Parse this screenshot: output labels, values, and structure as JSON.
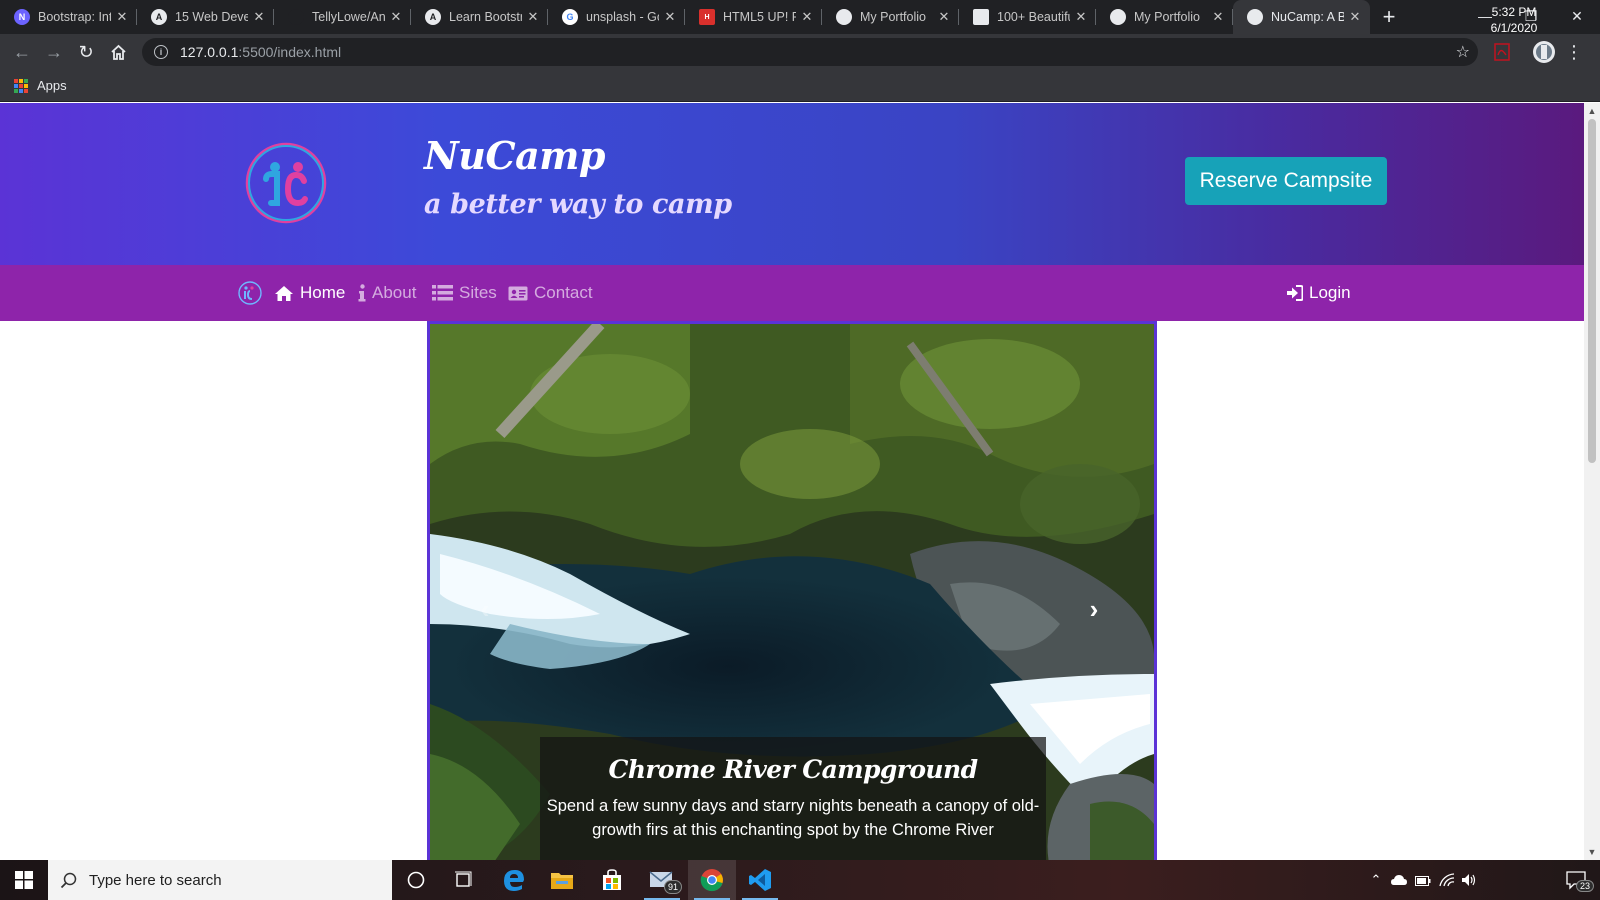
{
  "browser": {
    "tabs": [
      {
        "title": "Bootstrap: Int",
        "favicon": "nucamp-icon",
        "color": "#6c63ff"
      },
      {
        "title": "15 Web Devel",
        "favicon": "a-icon",
        "color": "#e8eaed"
      },
      {
        "title": "TellyLowe/An",
        "favicon": "github-icon",
        "color": "#202124"
      },
      {
        "title": "Learn Bootstr",
        "favicon": "a-icon",
        "color": "#e8eaed"
      },
      {
        "title": "unsplash - Go",
        "favicon": "google-icon",
        "color": "#ffffff"
      },
      {
        "title": "HTML5 UP! R",
        "favicon": "html5up-icon",
        "color": "#d9302c"
      },
      {
        "title": "My Portfolio",
        "favicon": "globe-icon",
        "color": "#e8eaed"
      },
      {
        "title": "100+ Beautifu",
        "favicon": "unsplash-icon",
        "color": "#e8eaed"
      },
      {
        "title": "My Portfolio",
        "favicon": "globe-icon",
        "color": "#e8eaed"
      },
      {
        "title": "NuCamp: A B",
        "favicon": "globe-icon",
        "color": "#e8eaed",
        "active": true
      }
    ],
    "address": {
      "host": "127.0.0.1",
      "path": ":5500/index.html"
    },
    "bookmarks": {
      "apps_label": "Apps"
    }
  },
  "page": {
    "brand": {
      "title": "NuCamp",
      "subtitle": "a better way to camp"
    },
    "reserve_label": "Reserve Campsite",
    "nav": {
      "home": "Home",
      "about": "About",
      "sites": "Sites",
      "contact": "Contact",
      "login": "Login"
    },
    "carousel": {
      "caption_title": "Chrome River Campground",
      "caption_text": "Spend a few sunny days and starry nights beneath a canopy of old-growth firs at this enchanting spot by the Chrome River"
    },
    "colors": {
      "jumbotron": "#3c4ad8",
      "navbar": "#8e24aa",
      "reserve": "#17a2b8"
    }
  },
  "taskbar": {
    "search_placeholder": "Type here to search",
    "mail_badge": "91",
    "time": "5:32 PM",
    "date": "6/1/2020",
    "notifications": "23"
  }
}
